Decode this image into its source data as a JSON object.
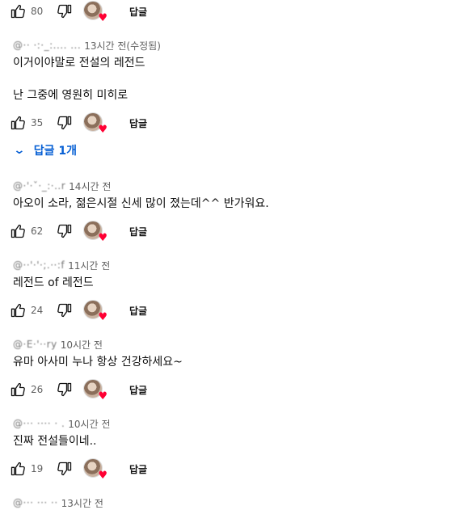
{
  "reply_label": "답글",
  "comments": [
    {
      "likes": "80"
    },
    {
      "author": "@·· ·:·_:.... ...",
      "time": "13시간 전(수정됨)",
      "lines": [
        "이거이야말로 전설의 레전드",
        "",
        "난 그중에 영원히 미히로"
      ],
      "likes": "35",
      "replies_toggle": "답글 1개"
    },
    {
      "author": "@·'·ˇ·_:·..r",
      "time": "14시간 전",
      "lines": [
        "아오이 소라, 젊은시절 신세 많이 졌는데^^  반가워요."
      ],
      "likes": "62"
    },
    {
      "author": "@··'·'·;.··:f",
      "time": "11시간 전",
      "lines": [
        "레전드 of 레전드"
      ],
      "likes": "24"
    },
    {
      "author": "@·E·'··ry",
      "time": "10시간 전",
      "lines": [
        "유마 아사미 누나 항상 건강하세요~"
      ],
      "likes": "26"
    },
    {
      "author": "@··· ···· · .",
      "time": "10시간 전",
      "lines": [
        "진짜 전설들이네.."
      ],
      "likes": "19"
    },
    {
      "author": "@··· ··· ··",
      "time": "13시간 전"
    }
  ]
}
